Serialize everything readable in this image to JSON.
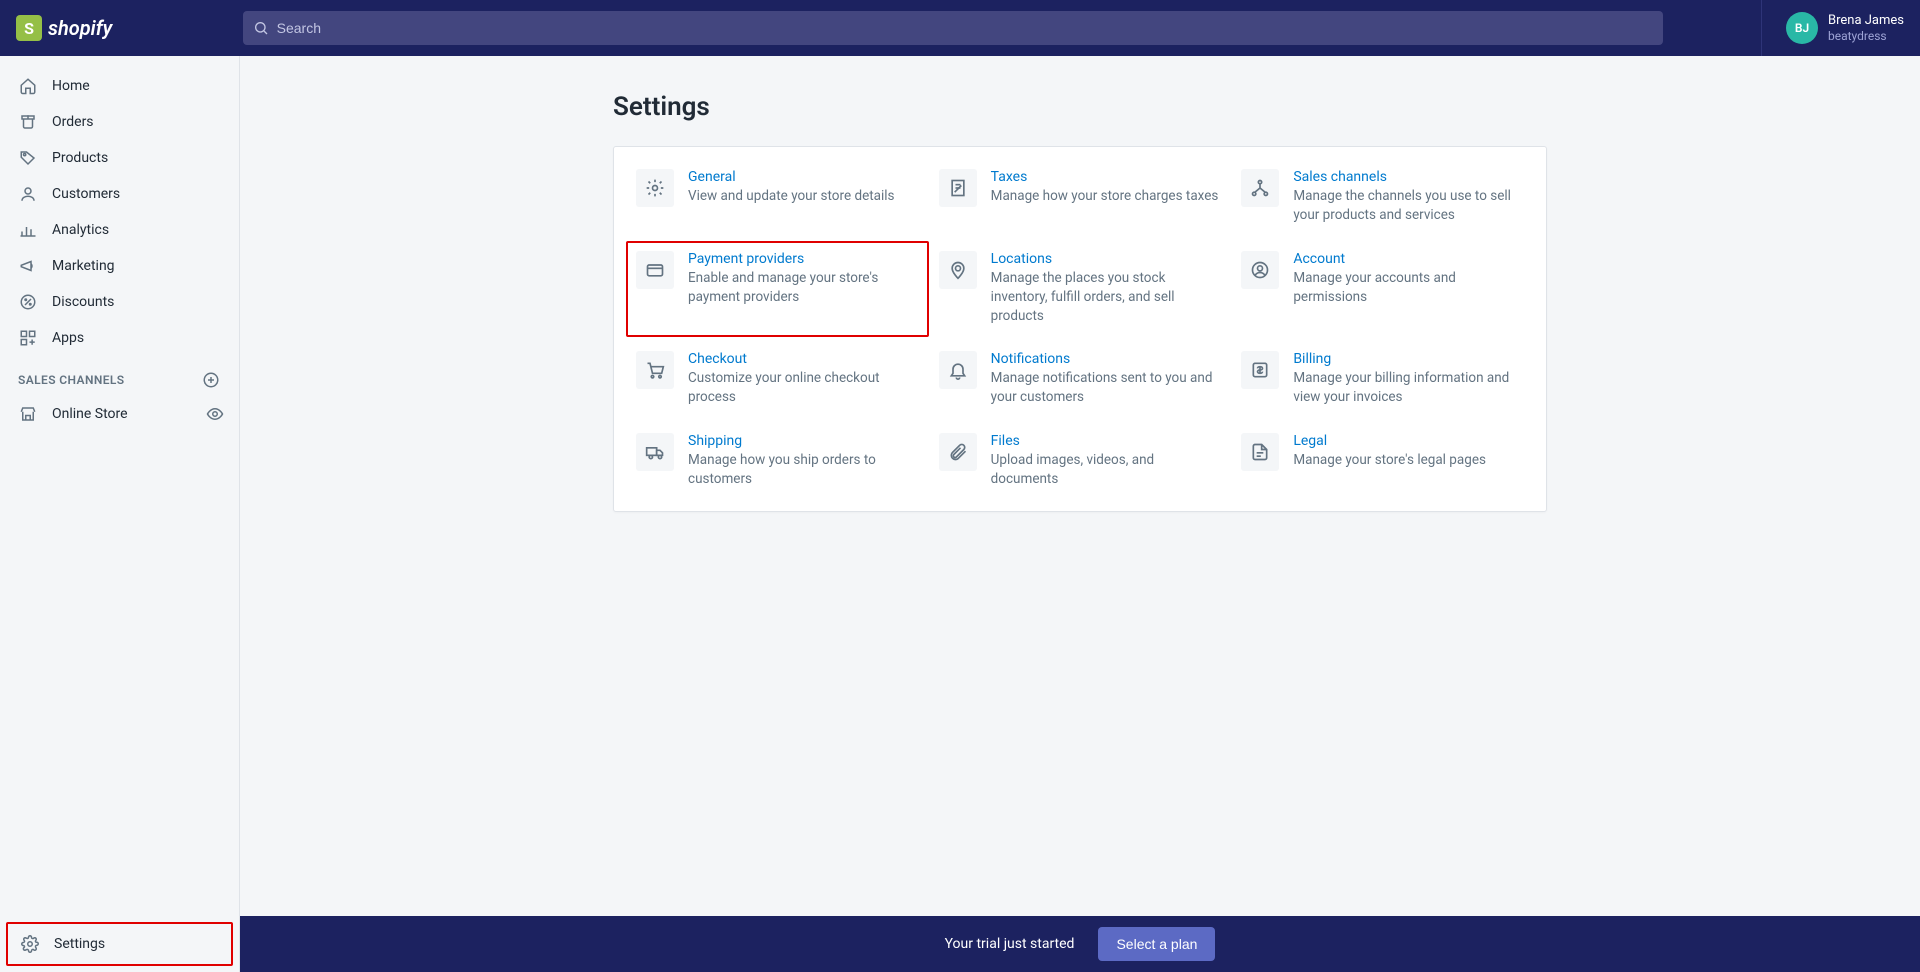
{
  "brand": "shopify",
  "search": {
    "placeholder": "Search"
  },
  "user": {
    "initials": "BJ",
    "name": "Brena James",
    "store": "beatydress"
  },
  "sidebar": {
    "items": [
      {
        "label": "Home"
      },
      {
        "label": "Orders"
      },
      {
        "label": "Products"
      },
      {
        "label": "Customers"
      },
      {
        "label": "Analytics"
      },
      {
        "label": "Marketing"
      },
      {
        "label": "Discounts"
      },
      {
        "label": "Apps"
      }
    ],
    "section_label": "SALES CHANNELS",
    "online_store": "Online Store",
    "settings": "Settings"
  },
  "page": {
    "title": "Settings"
  },
  "tiles": [
    {
      "title": "General",
      "desc": "View and update your store details"
    },
    {
      "title": "Taxes",
      "desc": "Manage how your store charges taxes"
    },
    {
      "title": "Sales channels",
      "desc": "Manage the channels you use to sell your products and services"
    },
    {
      "title": "Payment providers",
      "desc": "Enable and manage your store's payment providers"
    },
    {
      "title": "Locations",
      "desc": "Manage the places you stock inventory, fulfill orders, and sell products"
    },
    {
      "title": "Account",
      "desc": "Manage your accounts and permissions"
    },
    {
      "title": "Checkout",
      "desc": "Customize your online checkout process"
    },
    {
      "title": "Notifications",
      "desc": "Manage notifications sent to you and your customers"
    },
    {
      "title": "Billing",
      "desc": "Manage your billing information and view your invoices"
    },
    {
      "title": "Shipping",
      "desc": "Manage how you ship orders to customers"
    },
    {
      "title": "Files",
      "desc": "Upload images, videos, and documents"
    },
    {
      "title": "Legal",
      "desc": "Manage your store's legal pages"
    }
  ],
  "bottombar": {
    "trial_text": "Your trial just started",
    "cta": "Select a plan"
  }
}
